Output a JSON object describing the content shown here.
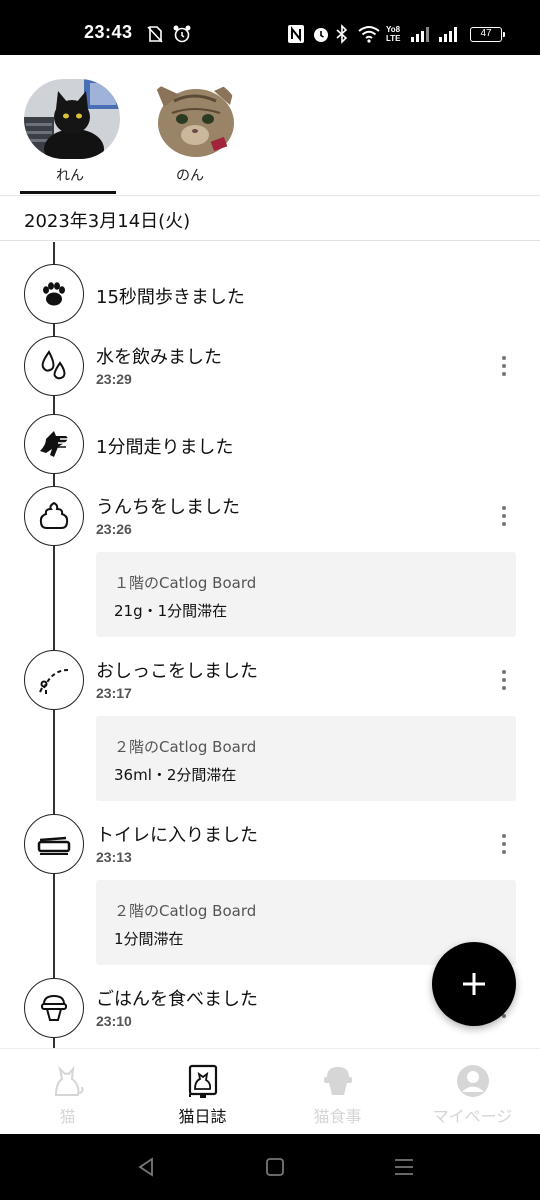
{
  "status_bar": {
    "time": "23:43",
    "battery": "47",
    "icons": [
      "sim-off-icon",
      "alarm-clock-icon",
      "nfc-icon",
      "alarm-icon",
      "bluetooth-icon",
      "wifi-icon",
      "volte-icon",
      "signal-icon",
      "signal-icon",
      "battery-icon"
    ]
  },
  "cats": [
    {
      "name": "れん",
      "selected": true,
      "avatar": "black-cat-photo"
    },
    {
      "name": "のん",
      "selected": false,
      "avatar": "tabby-cat-photo"
    }
  ],
  "date": "2023年3月14日(火)",
  "timeline": [
    {
      "icon": "paw-icon",
      "title": "15秒間歩きました",
      "time": null,
      "more": false
    },
    {
      "icon": "water-drops-icon",
      "title": "水を飲みました",
      "time": "23:29",
      "more": true
    },
    {
      "icon": "running-cat-icon",
      "title": "1分間走りました",
      "time": null,
      "more": false
    },
    {
      "icon": "poop-icon",
      "title": "うんちをしました",
      "time": "23:26",
      "more": true,
      "detail": {
        "board": "１階のCatlog Board",
        "info": "21g・1分間滞在"
      }
    },
    {
      "icon": "pee-icon",
      "title": "おしっこをしました",
      "time": "23:17",
      "more": true,
      "detail": {
        "board": "２階のCatlog Board",
        "info": "36ml・2分間滞在"
      }
    },
    {
      "icon": "litter-box-icon",
      "title": "トイレに入りました",
      "time": "23:13",
      "more": true,
      "detail": {
        "board": "２階のCatlog Board",
        "info": "1分間滞在"
      }
    },
    {
      "icon": "food-bowl-icon",
      "title": "ごはんを食べました",
      "time": "23:10",
      "more": true
    }
  ],
  "fab": {
    "icon": "plus-icon"
  },
  "bottom_nav": [
    {
      "label": "猫",
      "icon": "cat-icon",
      "active": false
    },
    {
      "label": "猫日誌",
      "icon": "cat-diary-icon",
      "active": true
    },
    {
      "label": "猫食事",
      "icon": "cat-food-icon",
      "active": false
    },
    {
      "label": "マイページ",
      "icon": "person-icon",
      "active": false
    }
  ],
  "colors": {
    "accent": "#000000",
    "timeline_line": "#333333",
    "card_bg": "#f3f3f3",
    "inactive_nav": "#d6d6d6"
  },
  "system_nav": [
    "back-icon",
    "home-icon",
    "menu-icon"
  ]
}
